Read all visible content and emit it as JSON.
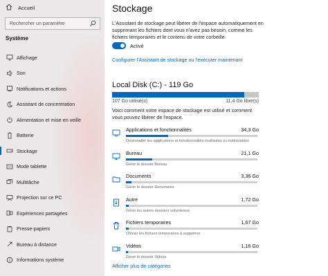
{
  "sidebar": {
    "home_label": "Accueil",
    "search_placeholder": "Rechercher un paramètre",
    "section_title": "Système",
    "items": [
      {
        "label": "Affichage",
        "icon": "display-icon"
      },
      {
        "label": "Son",
        "icon": "speaker-icon"
      },
      {
        "label": "Notifications et actions",
        "icon": "notification-icon"
      },
      {
        "label": "Assistant de concentration",
        "icon": "moon-icon"
      },
      {
        "label": "Alimentation et mise en veille",
        "icon": "power-icon"
      },
      {
        "label": "Batterie",
        "icon": "battery-icon"
      },
      {
        "label": "Stockage",
        "icon": "storage-icon",
        "active": true
      },
      {
        "label": "Mode tablette",
        "icon": "tablet-icon"
      },
      {
        "label": "Multitâche",
        "icon": "multitask-icon"
      },
      {
        "label": "Projection sur ce PC",
        "icon": "projection-icon"
      },
      {
        "label": "Expériences partagées",
        "icon": "shared-icon"
      },
      {
        "label": "Presse-papiers",
        "icon": "clipboard-icon"
      },
      {
        "label": "Bureau à distance",
        "icon": "remote-desktop-icon"
      },
      {
        "label": "Informations système",
        "icon": "info-icon"
      }
    ]
  },
  "main": {
    "title": "Stockage",
    "description": "L'Assistant de stockage peut libérer de l'espace automatiquement en supprimant les fichiers dont vous n'avez pas besoin, comme les fichiers temporaires et le contenu de votre corbeille.",
    "toggle_state": "Activé",
    "config_link": "Configurer l'Assistant de stockage ou l'exécuter maintenant",
    "disk": {
      "title": "Local Disk (C:) - 119 Go",
      "used_label": "107 Go utilisé(s)",
      "free_label": "11,4 Go libre(s)",
      "used_fraction": 0.9,
      "description": "Voici comment votre espace de stockage est utilisé et comment vous pouvez libérer de l'espace."
    },
    "categories": [
      {
        "name": "Applications et fonctionnalités",
        "size": "34,3 Go",
        "sub": "Désinstaller les applications et fonctionnalités inutilisées ou indésirables",
        "fraction": 0.32,
        "icon": "apps-icon"
      },
      {
        "name": "Bureau",
        "size": "21,1 Go",
        "sub": "Gérer le dossier Bureau",
        "fraction": 0.2,
        "icon": "desktop-icon"
      },
      {
        "name": "Documents",
        "size": "3,36 Go",
        "sub": "Gérer le dossier Documents",
        "fraction": 0.04,
        "icon": "documents-icon"
      },
      {
        "name": "Autre",
        "size": "1,72 Go",
        "sub": "Gérer les autres dossiers volumineux",
        "fraction": 0.02,
        "icon": "other-icon"
      },
      {
        "name": "Fichiers temporaires",
        "size": "1,67 Go",
        "sub": "Choisir les fichiers temporaires à supprimer",
        "fraction": 0.02,
        "icon": "trash-icon"
      },
      {
        "name": "Vidéos",
        "size": "1,16 Go",
        "sub": "Gérer le dossier Vidéos",
        "fraction": 0.015,
        "icon": "video-icon"
      }
    ],
    "more_link": "Afficher plus de catégories"
  },
  "colors": {
    "accent": "#0067c0",
    "sidebar_bg": "#ece8e9"
  }
}
